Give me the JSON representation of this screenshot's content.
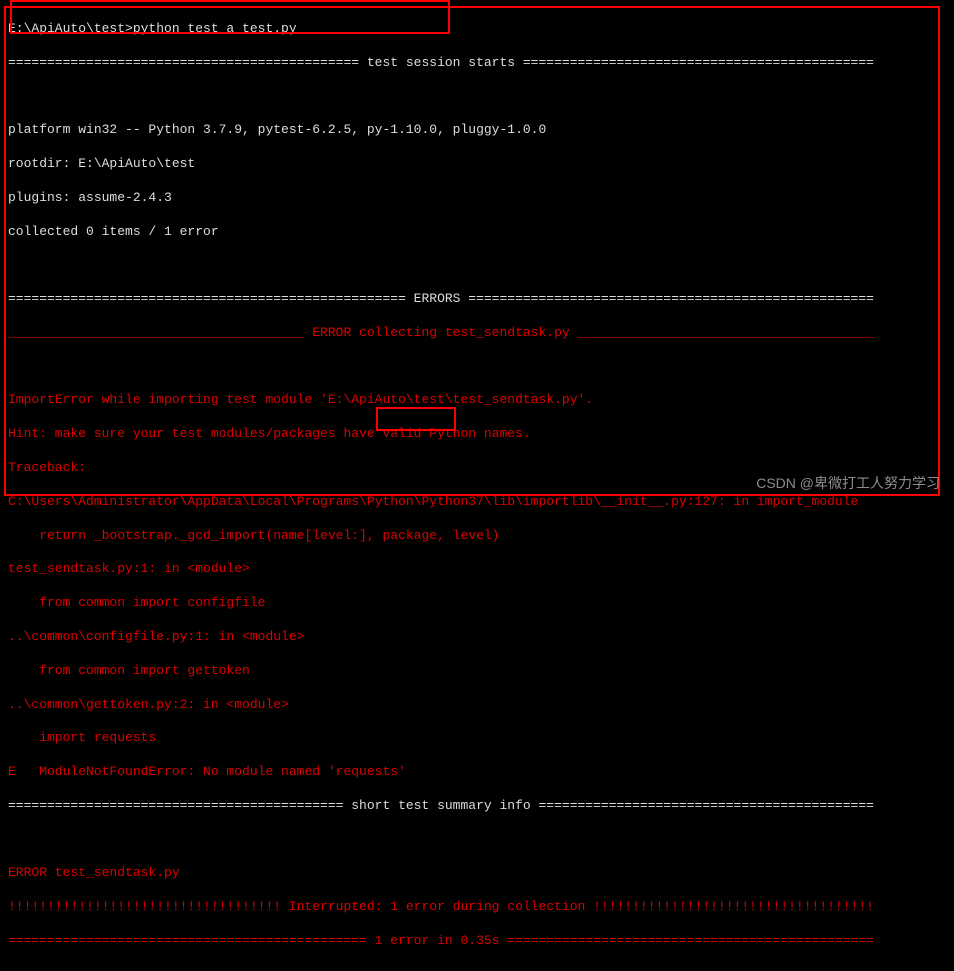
{
  "prompt_line": "E:\\ApiAuto\\test>python test_a_test.py",
  "session_line": "============================================= test session starts =============================================",
  "platform_line": "platform win32 -- Python 3.7.9, pytest-6.2.5, py-1.10.0, pluggy-1.0.0",
  "rootdir_line": "rootdir: E:\\ApiAuto\\test",
  "plugins_line": "plugins: assume-2.4.3",
  "collected_line": "collected 0 items / 1 error",
  "errors_header": "=================================================== ERRORS ====================================================",
  "error_collect_header": "______________________________________ ERROR collecting test_sendtask.py ______________________________________",
  "import_error_1": "ImportError while importing test module 'E:\\ApiAuto\\test\\test_sendtask.py'.",
  "import_error_2": "Hint: make sure your test modules/packages have valid Python names.",
  "import_error_3": "Traceback:",
  "import_error_4": "C:\\Users\\Administrator\\AppData\\Local\\Programs\\Python\\Python37\\lib\\importlib\\__init__.py:127: in import_module",
  "import_error_5": "    return _bootstrap._gcd_import(name[level:], package, level)",
  "import_error_6": "test_sendtask.py:1: in <module>",
  "import_error_7": "    from common import configfile",
  "import_error_8": "..\\common\\configfile.py:1: in <module>",
  "import_error_9": "    from common import gettoken",
  "import_error_10": "..\\common\\gettoken.py:2: in <module>",
  "import_error_11": "    import requests",
  "import_error_12": "E   ModuleNotFoundError: No module named 'requests'",
  "summary_header": "=========================================== short test summary info ===========================================",
  "summary_error": "ERROR test_sendtask.py",
  "interrupt_line": "!!!!!!!!!!!!!!!!!!!!!!!!!!!!!!!!!!! Interrupted: 1 error during collection !!!!!!!!!!!!!!!!!!!!!!!!!!!!!!!!!!!!",
  "final_line": "============================================== 1 error in 0.35s ===============================================",
  "watermark": "CSDN @卑微打工人努力学习"
}
